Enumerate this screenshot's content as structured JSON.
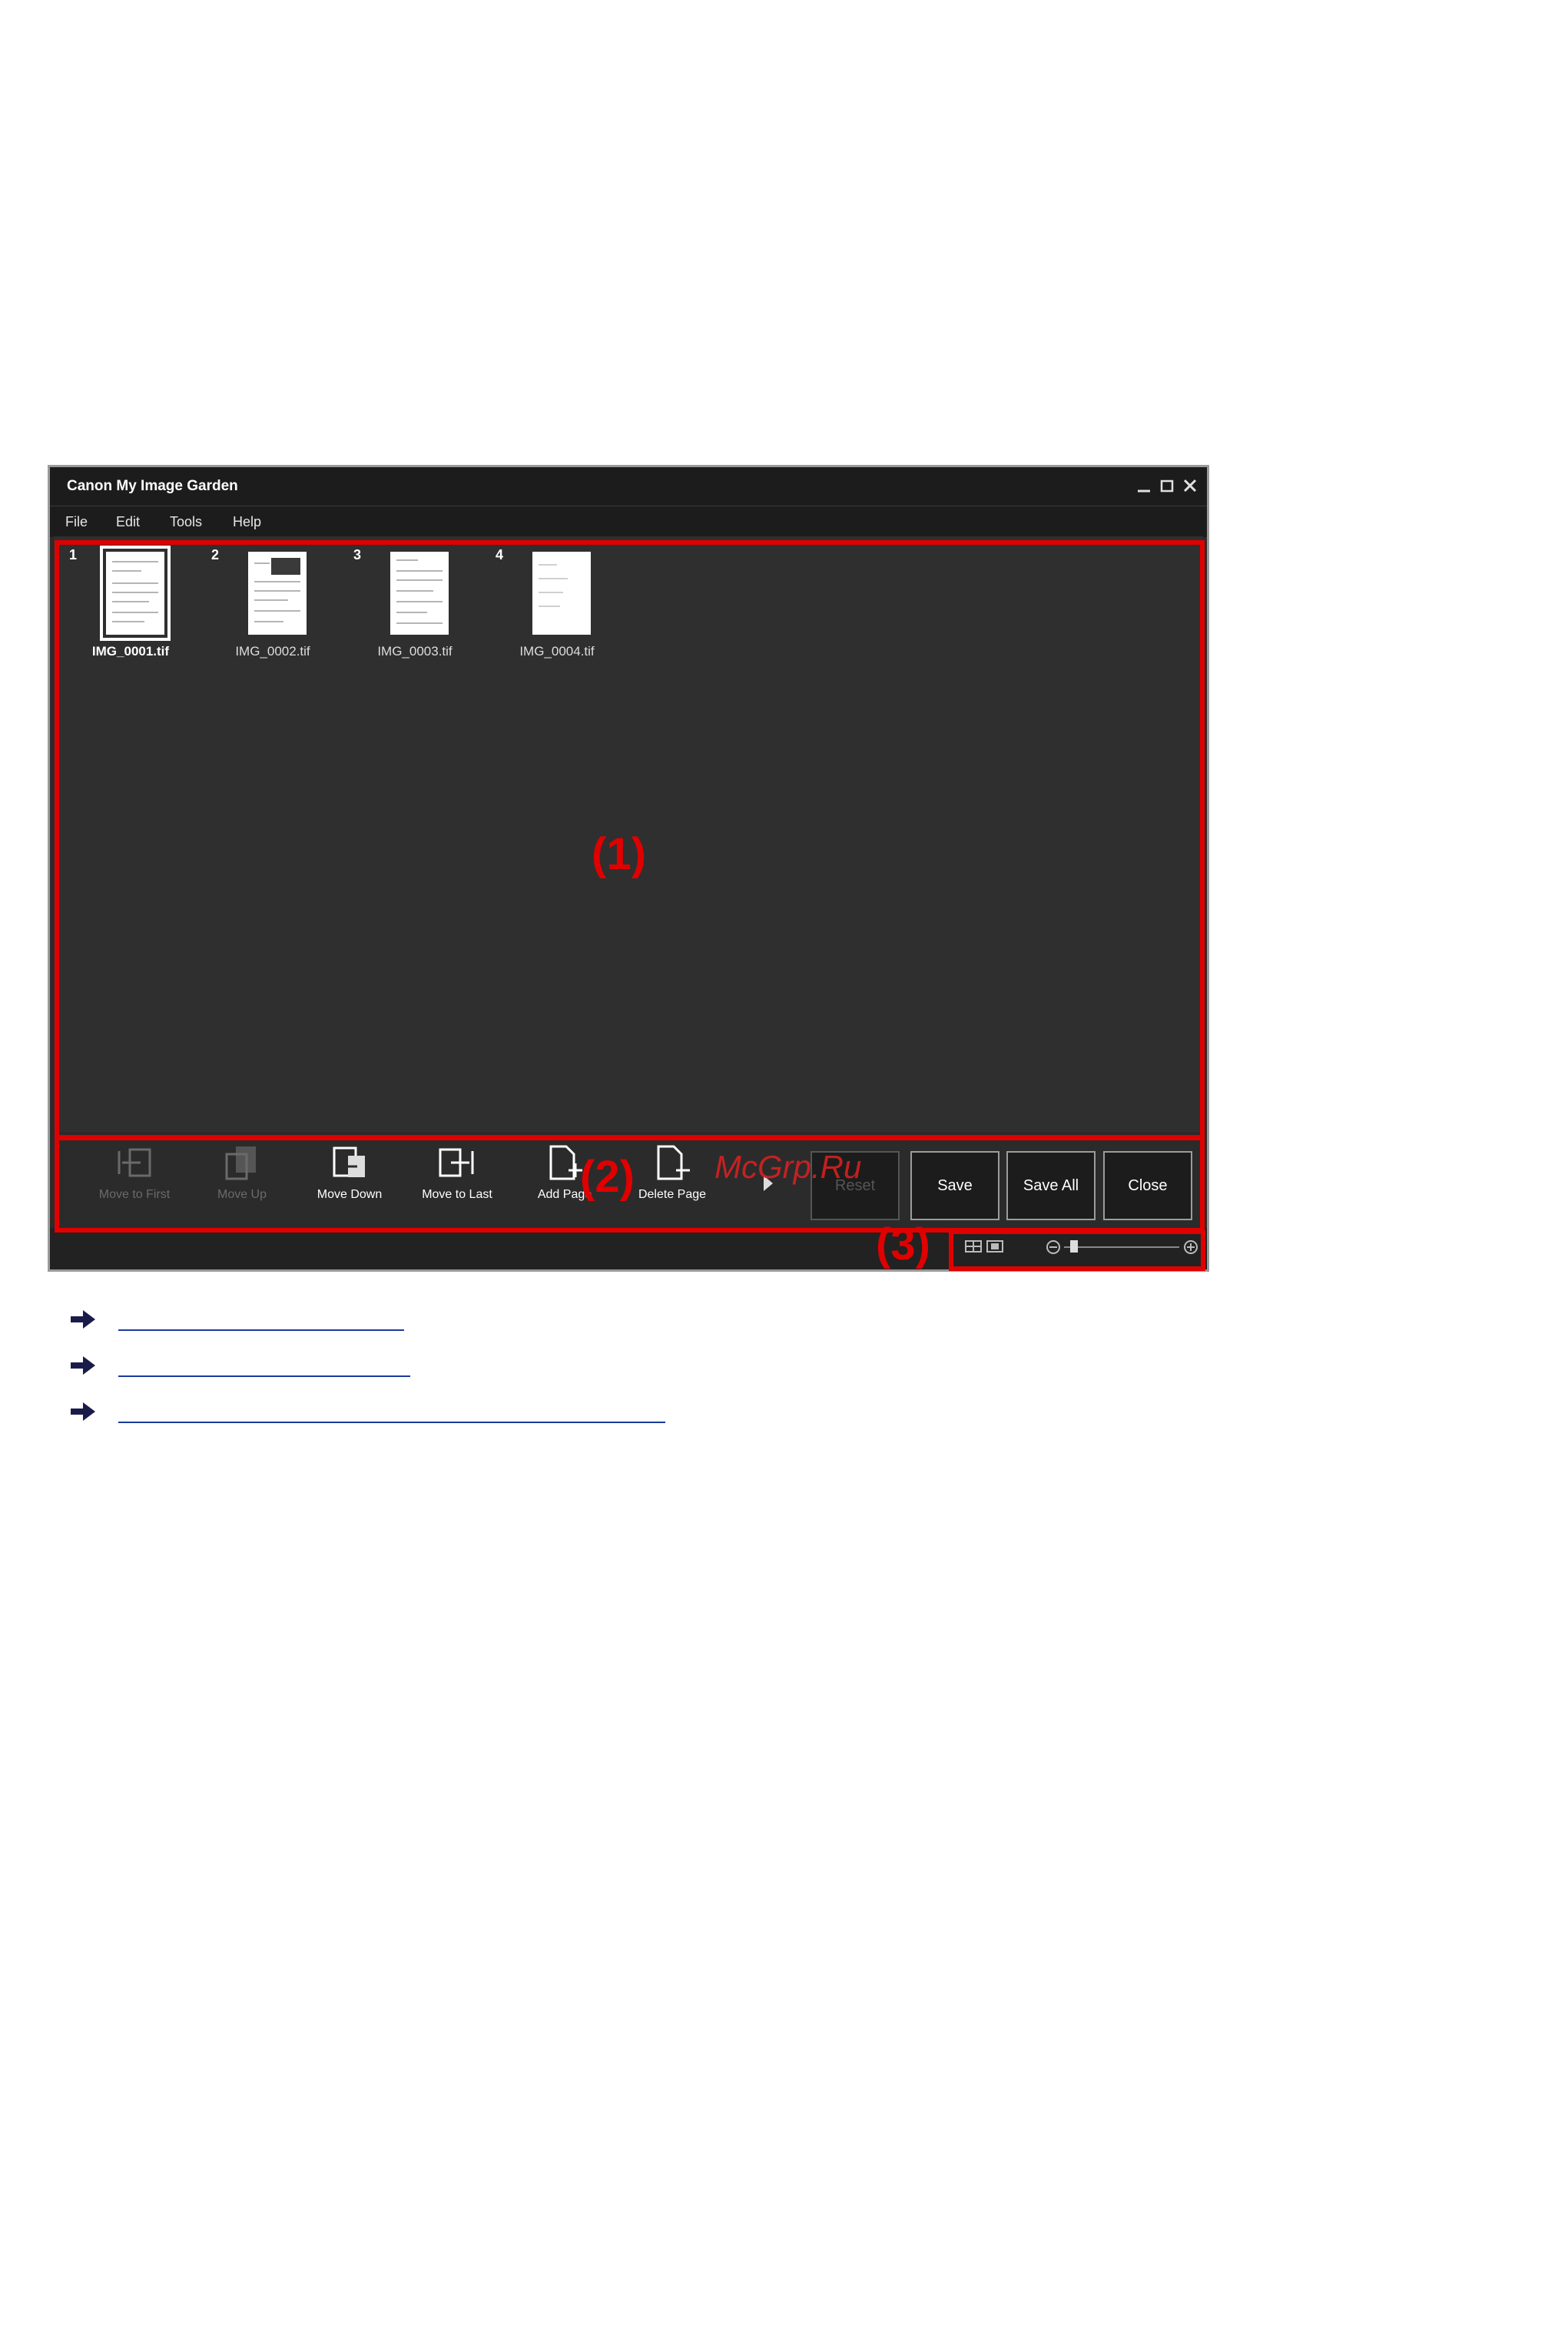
{
  "window": {
    "title": "Canon My Image Garden"
  },
  "menu": {
    "items": [
      "File",
      "Edit",
      "Tools",
      "Help"
    ]
  },
  "thumbnails": [
    {
      "number": "1",
      "name": "IMG_0001.tif",
      "selected": true
    },
    {
      "number": "2",
      "name": "IMG_0002.tif",
      "selected": false
    },
    {
      "number": "3",
      "name": "IMG_0003.tif",
      "selected": false
    },
    {
      "number": "4",
      "name": "IMG_0004.tif",
      "selected": false
    }
  ],
  "toolbar": {
    "move_to_first": "Move to First",
    "move_up": "Move Up",
    "move_down": "Move Down",
    "move_to_last": "Move to Last",
    "add_page": "Add Page",
    "delete_page": "Delete Page",
    "buttons": {
      "first": "Reset",
      "save": "Save",
      "save_all": "Save All",
      "close": "Close"
    }
  },
  "annotations": {
    "area1": "(1)",
    "area2": "(2)",
    "area3": "(3)"
  },
  "watermark": "McGrp.Ru",
  "colors": {
    "annotation_red": "#e00000",
    "window_bg": "#2b2b2b",
    "titlebar_bg": "#1c1c1c",
    "link_arrow": "#1b1b4a"
  },
  "icons": [
    "minimize-icon",
    "maximize-icon",
    "close-icon",
    "list-view-icon",
    "thumbnail-view-icon",
    "zoom-out-icon",
    "zoom-in-icon",
    "link-arrow-icon"
  ]
}
